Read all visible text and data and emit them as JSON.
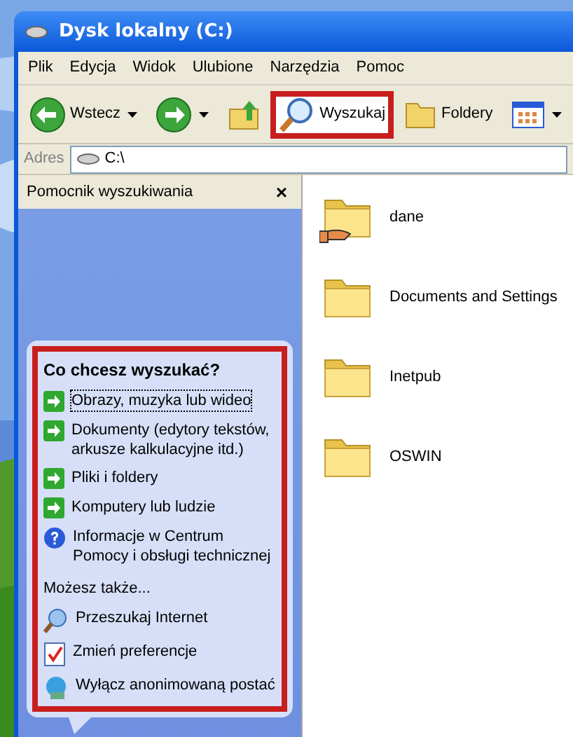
{
  "window": {
    "title": "Dysk lokalny (C:)"
  },
  "menu": [
    "Plik",
    "Edycja",
    "Widok",
    "Ulubione",
    "Narzędzia",
    "Pomoc"
  ],
  "toolbar": [
    {
      "kind": "back",
      "label": "Wstecz",
      "highlighted": false
    },
    {
      "kind": "forward",
      "highlighted": false
    },
    {
      "kind": "up",
      "highlighted": false
    },
    {
      "kind": "search",
      "label": "Wyszukaj",
      "highlighted": true
    },
    {
      "kind": "folders",
      "label": "Foldery",
      "highlighted": false
    },
    {
      "kind": "views",
      "highlighted": false
    }
  ],
  "address": {
    "label": "Adres",
    "value": "C:\\"
  },
  "search_pane": {
    "title": "Pomocnik wyszukiwania",
    "close": "×",
    "highlighted": true,
    "heading": "Co chcesz wyszukać?",
    "options": [
      {
        "kind": "arrow",
        "label": "Obrazy, muzyka lub wideo",
        "focused": true
      },
      {
        "kind": "arrow",
        "label": "Dokumenty (edytory tekstów, arkusze kalkulacyjne itd.)",
        "focused": false
      },
      {
        "kind": "arrow",
        "label": "Pliki i foldery",
        "focused": false
      },
      {
        "kind": "arrow",
        "label": "Komputery lub ludzie",
        "focused": false
      },
      {
        "kind": "help",
        "label": "Informacje w Centrum Pomocy i obsługi technicznej",
        "focused": false
      }
    ],
    "also_heading": "Możesz także...",
    "also": [
      {
        "kind": "internet",
        "label": "Przeszukaj Internet"
      },
      {
        "kind": "preferences",
        "label": "Zmień preferencje"
      },
      {
        "kind": "character",
        "label": "Wyłącz anonimowaną postać"
      }
    ]
  },
  "files": [
    {
      "name": "dane",
      "kind": "shared"
    },
    {
      "name": "Documents and Settings",
      "kind": "folder"
    },
    {
      "name": "Inetpub",
      "kind": "folder"
    },
    {
      "name": "OSWIN",
      "kind": "folder"
    }
  ]
}
